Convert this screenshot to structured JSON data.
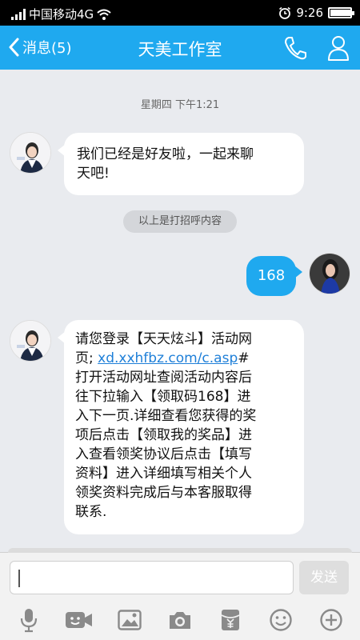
{
  "status_bar": {
    "carrier": "中国移动4G",
    "time": "9:26",
    "battery_level": 0.95
  },
  "nav": {
    "back_label": "消息(5)",
    "title": "天美工作室"
  },
  "chat": {
    "timestamp": "星期四 下午1:21",
    "messages": [
      {
        "from": "them",
        "text_lines": [
          "我们已经是好友啦，一起来聊",
          "天吧!"
        ]
      },
      {
        "from": "system",
        "text": "以上是打招呼内容"
      },
      {
        "from": "me",
        "text": "168"
      },
      {
        "from": "them",
        "line1": "请您登录【天天炫斗】活动网",
        "line2_prefix": "页; ",
        "link": "xd.xxhfbz.com/c.asp",
        "line2_suffix": "#",
        "rest_lines": [
          "打开活动网址查阅活动内容后",
          "往下拉输入【领取码168】进",
          "入下一页.详细查看您获得的奖",
          "项后点击【领取我的奖品】进",
          "入查看领奖协议后点击【填写",
          "资料】进入详细填写相关个人",
          "领奖资料完成后与本客服取得",
          "联系."
        ]
      }
    ]
  },
  "input": {
    "value": "",
    "send_label": "发送"
  },
  "toolbar": {
    "icons": [
      "microphone-icon",
      "video-icon",
      "image-icon",
      "camera-icon",
      "red-packet-icon",
      "emoji-icon",
      "plus-icon"
    ]
  },
  "colors": {
    "accent": "#1fa9ef",
    "background": "#e9ebef",
    "link": "#1e7fd8"
  }
}
